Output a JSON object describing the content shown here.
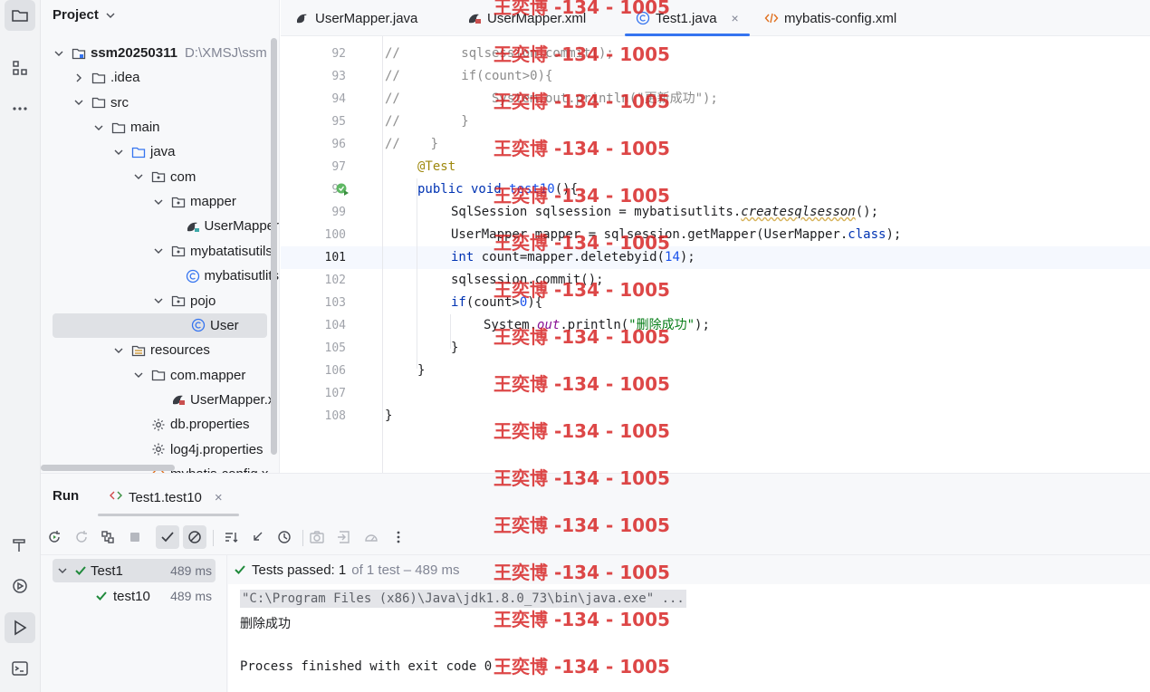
{
  "project_panel": {
    "title": "Project",
    "tree": [
      {
        "label": "ssm20250311",
        "path": "D:\\XMSJ\\ssm",
        "icon": "module-icon",
        "expanded": true
      },
      {
        "label": ".idea",
        "icon": "folder-icon",
        "expanded": false
      },
      {
        "label": "src",
        "icon": "folder-icon",
        "expanded": true
      },
      {
        "label": "main",
        "icon": "folder-icon",
        "expanded": true
      },
      {
        "label": "java",
        "icon": "source-folder-icon",
        "expanded": true
      },
      {
        "label": "com",
        "icon": "package-icon",
        "expanded": true
      },
      {
        "label": "mapper",
        "icon": "package-icon",
        "expanded": true
      },
      {
        "label": "UserMapper",
        "icon": "mybatis-interface-icon"
      },
      {
        "label": "mybatatisutils",
        "icon": "package-icon",
        "expanded": true
      },
      {
        "label": "mybatisutlits",
        "icon": "class-icon"
      },
      {
        "label": "pojo",
        "icon": "package-icon",
        "expanded": true
      },
      {
        "label": "User",
        "icon": "class-icon"
      },
      {
        "label": "resources",
        "icon": "resources-folder-icon",
        "expanded": true
      },
      {
        "label": "com.mapper",
        "icon": "folder-icon",
        "expanded": true
      },
      {
        "label": "UserMapper.x",
        "icon": "mybatis-xml-icon"
      },
      {
        "label": "db.properties",
        "icon": "properties-icon"
      },
      {
        "label": "log4j.properties",
        "icon": "properties-icon"
      },
      {
        "label": "mybatis-config.x",
        "icon": "xml-icon"
      }
    ]
  },
  "tabs": [
    {
      "label": "UserMapper.java",
      "icon": "mybatis-interface-icon"
    },
    {
      "label": "UserMapper.xml",
      "icon": "mybatis-xml-icon"
    },
    {
      "label": "Test1.java",
      "icon": "class-icon",
      "active": true,
      "close": "×"
    },
    {
      "label": "mybatis-config.xml",
      "icon": "xml-icon"
    }
  ],
  "editor": {
    "line_numbers": [
      "92",
      "93",
      "94",
      "95",
      "96",
      "97",
      "98",
      "99",
      "100",
      "101",
      "102",
      "103",
      "104",
      "105",
      "106",
      "107",
      "108"
    ],
    "current_line": "101",
    "code": {
      "l92_comment": "//        sqlsession.commit();",
      "l93_comment": "//        if(count>0){",
      "l94_comment": "//            System.out.println(\"更新成功\");",
      "l95_comment": "//        }",
      "l96_comment": "//    }",
      "l97_annotation": "@Test",
      "l98_kw": "public void ",
      "l98_name": "test10",
      "l98_rest": "(){",
      "l99_a": "SqlSession sqlsession = mybatisutlits.",
      "l99_method": "createsqlsesson",
      "l99_b": "();",
      "l100_a": "UserMapper mapper = sqlsession.getMapper(UserMapper.",
      "l100_kw": "class",
      "l100_b": ");",
      "l101_kw": "int ",
      "l101_a": "count=mapper.deletebyid(",
      "l101_num": "14",
      "l101_b": ");",
      "l102": "sqlsession.commit();",
      "l103_kw": "if",
      "l103_a": "(count>",
      "l103_num": "0",
      "l103_b": "){",
      "l104_a": "System.",
      "l104_field": "out",
      "l104_b": ".println(",
      "l104_str": "\"删除成功\"",
      "l104_c": ");",
      "l105": "}",
      "l106": "}",
      "l108": "}"
    }
  },
  "run_panel": {
    "title": "Run",
    "tab_label": "Test1.test10",
    "tab_close": "×",
    "tests": [
      {
        "name": "Test1",
        "time": "489 ms",
        "status": "passed"
      },
      {
        "name": "test10",
        "time": "489 ms",
        "status": "passed"
      }
    ],
    "status_prefix": "Tests passed: ",
    "status_count": "1",
    "status_suffix": "of 1 test – 489 ms",
    "console": {
      "command": "\"C:\\Program Files (x86)\\Java\\jdk1.8.0_73\\bin\\java.exe\" ...",
      "output": "删除成功",
      "exit": "Process finished with exit code 0"
    }
  },
  "watermark": "王奕博 -134 - 1005",
  "colors": {
    "accent": "#3574f0",
    "pass_green": "#208a3c",
    "keyword": "#0033b3",
    "annotation": "#9e880d",
    "comment": "#8c8c8c",
    "string": "#067d17",
    "number": "#1750eb",
    "watermark": "#d61e1e"
  }
}
